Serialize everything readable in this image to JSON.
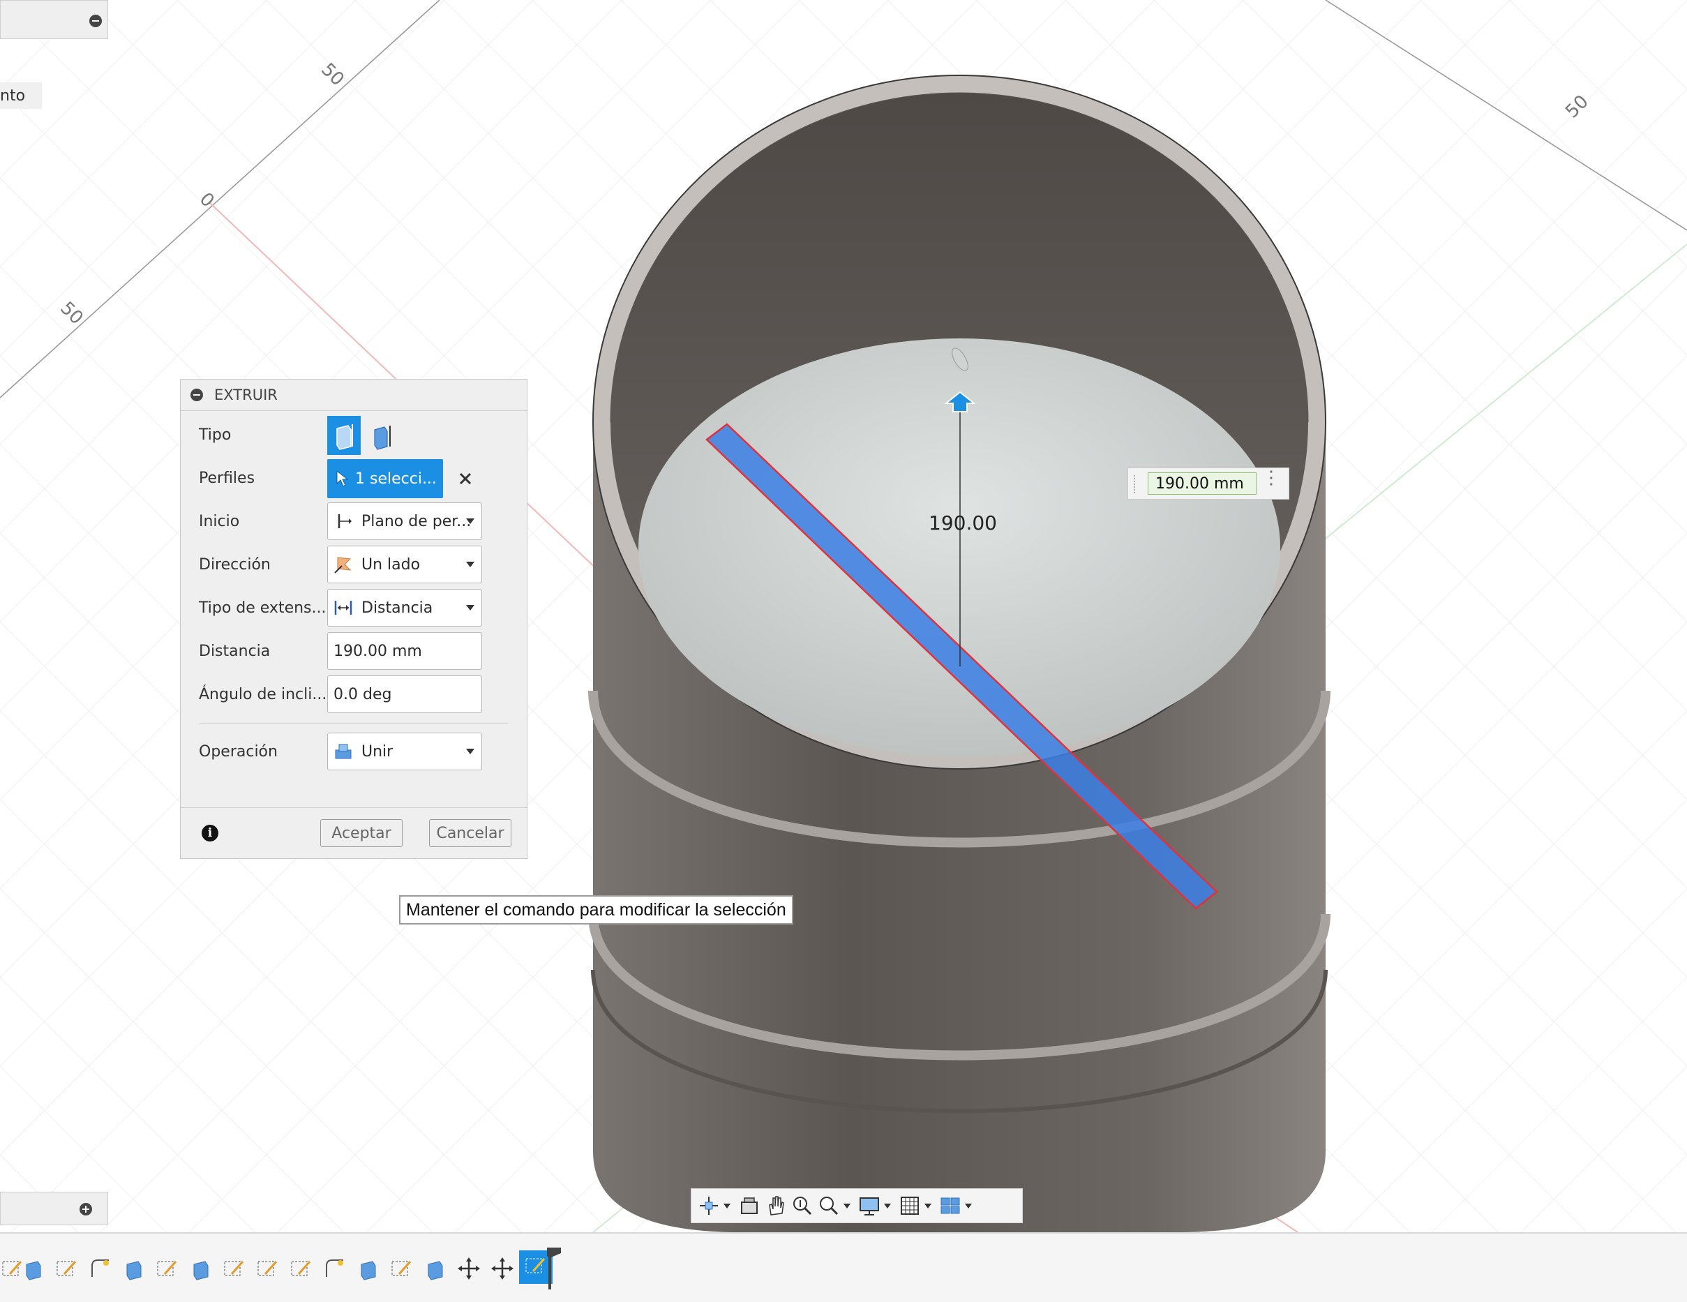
{
  "viewport": {
    "ruler_labels": [
      "50",
      "0",
      "50",
      "50"
    ]
  },
  "dialog": {
    "title": "EXTRUIR",
    "rows": {
      "type": {
        "label": "Tipo"
      },
      "profiles": {
        "label": "Perfiles",
        "value": "1 selecci..."
      },
      "start": {
        "label": "Inicio",
        "value": "Plano de per..."
      },
      "direction": {
        "label": "Dirección",
        "value": "Un lado"
      },
      "extent": {
        "label": "Tipo de extens...",
        "value": "Distancia"
      },
      "distance": {
        "label": "Distancia",
        "value": "190.00 mm"
      },
      "taper": {
        "label": "Ángulo de incli...",
        "value": "0.0 deg"
      },
      "operation": {
        "label": "Operación",
        "value": "Unir"
      }
    },
    "ok_label": "Aceptar",
    "cancel_label": "Cancelar",
    "info_glyph": "i"
  },
  "tooltip": "Mantener el comando para modificar la selección",
  "dimension": {
    "input_value": "190.00 mm",
    "label": "190.00"
  },
  "side_panel": {
    "partial_label": "nto"
  },
  "colors": {
    "accent": "#1a8fe3",
    "body": "#6f6965",
    "selection": "#4a86e8",
    "highlight_edge": "#e0323a"
  }
}
